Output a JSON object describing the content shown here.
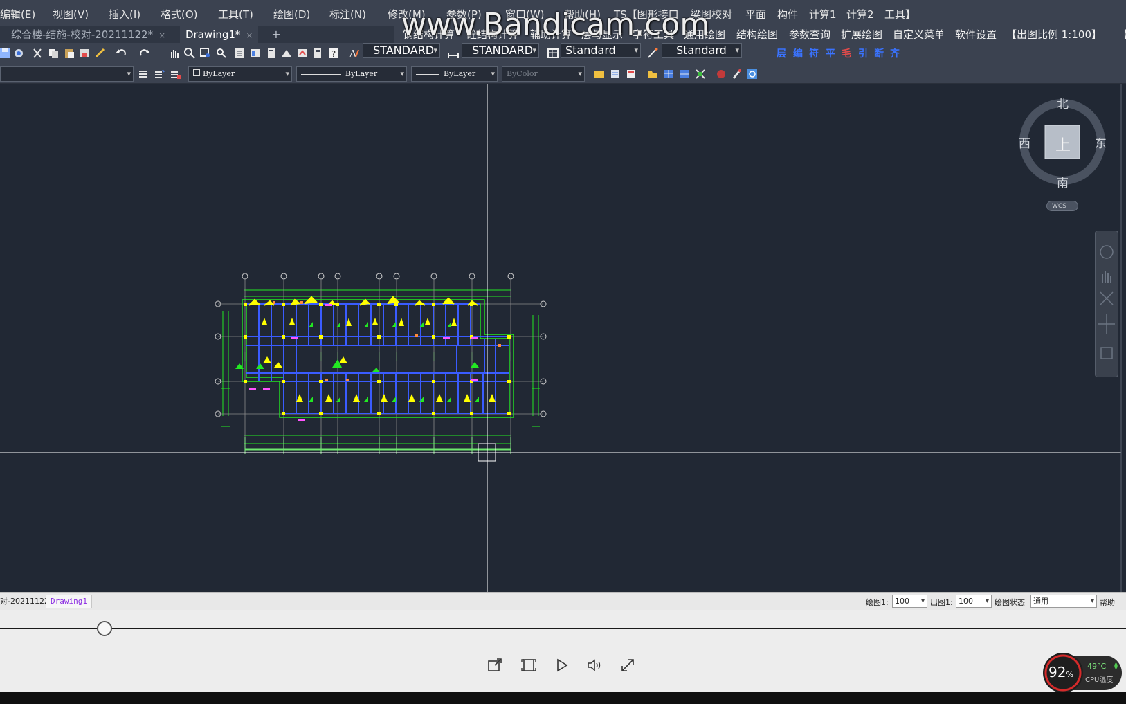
{
  "menubar": {
    "items": [
      "编辑(E)",
      "视图(V)",
      "插入(I)",
      "格式(O)",
      "工具(T)",
      "绘图(D)",
      "标注(N)",
      "修改(M)",
      "参数(P)",
      "窗口(W)",
      "帮助(H)",
      "TS【图形接口",
      "梁图校对",
      "平面",
      "构件",
      "计算1",
      "计算2",
      "工具】"
    ]
  },
  "watermark": "www.Bandicam.com",
  "tabs": [
    {
      "label": "综合楼-结施-校对-20211122*",
      "close": "×"
    },
    {
      "label": "Drawing1*",
      "close": "×"
    }
  ],
  "tab_add": "+",
  "menu2": {
    "items": [
      "钢结构计算",
      "砼结构计算",
      "辅助计算",
      "层与显示",
      "字符工具",
      "通用绘图",
      "结构绘图",
      "参数查询",
      "扩展绘图",
      "自定义菜单",
      "软件设置",
      "【出图比例 1:100】",
      "【"
    ]
  },
  "toolbar1": {
    "text_style": "STANDARD",
    "dim_style": "STANDARD",
    "table_style": "Standard",
    "multileader_style": "Standard",
    "tssd_symbols": [
      "层",
      "编",
      "符",
      "平",
      "毛",
      "引",
      "断",
      "齐"
    ]
  },
  "toolbar2": {
    "layer_value": "",
    "color_value": "ByLayer",
    "linetype_value": "ByLayer",
    "lineweight_value": "ByLayer",
    "plotstyle_value": "ByColor"
  },
  "viewcube": {
    "north": "北",
    "south": "南",
    "east": "东",
    "west": "西",
    "face": "上",
    "wcs": "WCS"
  },
  "layout_tabs": {
    "left_partial": "对-20211122",
    "active": "Drawing1"
  },
  "statusbar": {
    "draw_scale_label": "绘图1:",
    "draw_scale_value": "100",
    "plot_scale_label": "出图1:",
    "plot_scale_value": "100",
    "draw_state_label": "绘图状态",
    "draw_state_value": "通用",
    "help": "帮助"
  },
  "player": {
    "progress": 0.093
  },
  "cpu": {
    "usage": "92",
    "usage_unit": "%",
    "temp": "49°C",
    "temp_label": "CPU温度"
  },
  "colors": {
    "canvas": "#212834",
    "ui_dark": "#3b4250",
    "plan_green": "#22e822",
    "plan_yellow": "#ffff00",
    "plan_blue": "#3a5cff",
    "plan_magenta": "#ff55ff"
  }
}
